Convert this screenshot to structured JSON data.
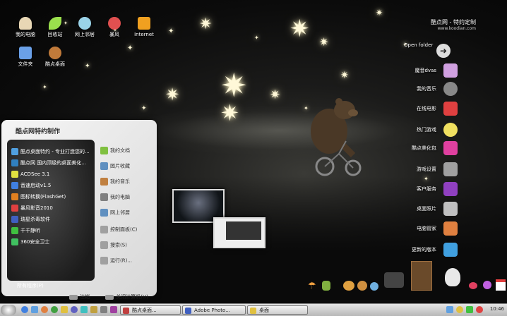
{
  "desktop": {
    "icons": [
      {
        "label": "我的电脑",
        "color": "#e8d7b5"
      },
      {
        "label": "回收站",
        "color": "#9be04d"
      },
      {
        "label": "网上邻居",
        "color": "#9ad3e8"
      },
      {
        "label": "暴风",
        "color": "#e05050"
      },
      {
        "label": "Internet",
        "color": "#f0a020"
      },
      {
        "label": "文件夹",
        "color": "#6aa0e8"
      },
      {
        "label": "酷点桌面",
        "color": "#c07a3a"
      }
    ],
    "logo": {
      "title": "酷点网 - 特约定制",
      "url": "www.koodian.com"
    },
    "dock_open_folder": "Open folder",
    "dock": [
      {
        "label": "魔音dvas",
        "color": "#d0a0e0"
      },
      {
        "label": "我的音乐",
        "color": "#888888"
      },
      {
        "label": "在线电影",
        "color": "#e04040"
      },
      {
        "label": "热门游戏",
        "color": "#f0e060"
      },
      {
        "label": "酷点美化包",
        "color": "#e040a0"
      },
      {
        "label": "游戏设置",
        "color": "#a0a0a0"
      },
      {
        "label": "客户服务",
        "color": "#9040c0"
      },
      {
        "label": "桌面照片",
        "color": "#c0c0c0"
      },
      {
        "label": "电脑管家",
        "color": "#e08040"
      },
      {
        "label": "更新的版本",
        "color": "#40a0e0"
      }
    ]
  },
  "start_menu": {
    "header": "酷点网特约制作",
    "left_items": [
      {
        "label": "酷点桌面特约 - 专业打造您的...",
        "color": "#50a0e0"
      },
      {
        "label": "酷点网 国内顶级的桌面美化...",
        "color": "#3080c0"
      },
      {
        "label": "ACDSee 3.1",
        "color": "#e0e040"
      },
      {
        "label": "音速启动v1.5",
        "color": "#4080e0"
      },
      {
        "label": "图标转换(FlashGet)",
        "color": "#e08020"
      },
      {
        "label": "暴风影音2010",
        "color": "#e04040"
      },
      {
        "label": "瑞星杀毒软件",
        "color": "#4060c0"
      },
      {
        "label": "千千静听",
        "color": "#40c040"
      },
      {
        "label": "360安全卫士",
        "color": "#40c060"
      }
    ],
    "right_items": [
      {
        "label": "我的文档",
        "color": "#80c040"
      },
      {
        "label": "图片收藏",
        "color": "#6090c0"
      },
      {
        "label": "我的音乐",
        "color": "#c08040"
      },
      {
        "label": "我的电脑",
        "color": "#808080"
      },
      {
        "label": "网上邻居",
        "color": "#6090c0"
      },
      {
        "label": "控制面板(C)",
        "color": "#a0a0a0"
      },
      {
        "label": "搜索(S)",
        "color": "#a0a0a0"
      },
      {
        "label": "运行(R)...",
        "color": "#a0a0a0"
      }
    ],
    "all_programs": "所有程序(P)",
    "logoff": "注销",
    "shutdown": "关闭计算机(U)"
  },
  "taskbar": {
    "tasks": [
      {
        "label": "酷点桌面...",
        "color": "#c04040"
      },
      {
        "label": "Adobe Photo...",
        "color": "#4060c0"
      },
      {
        "label": "桌面",
        "color": "#e0c040"
      }
    ],
    "clock": "10:46"
  }
}
